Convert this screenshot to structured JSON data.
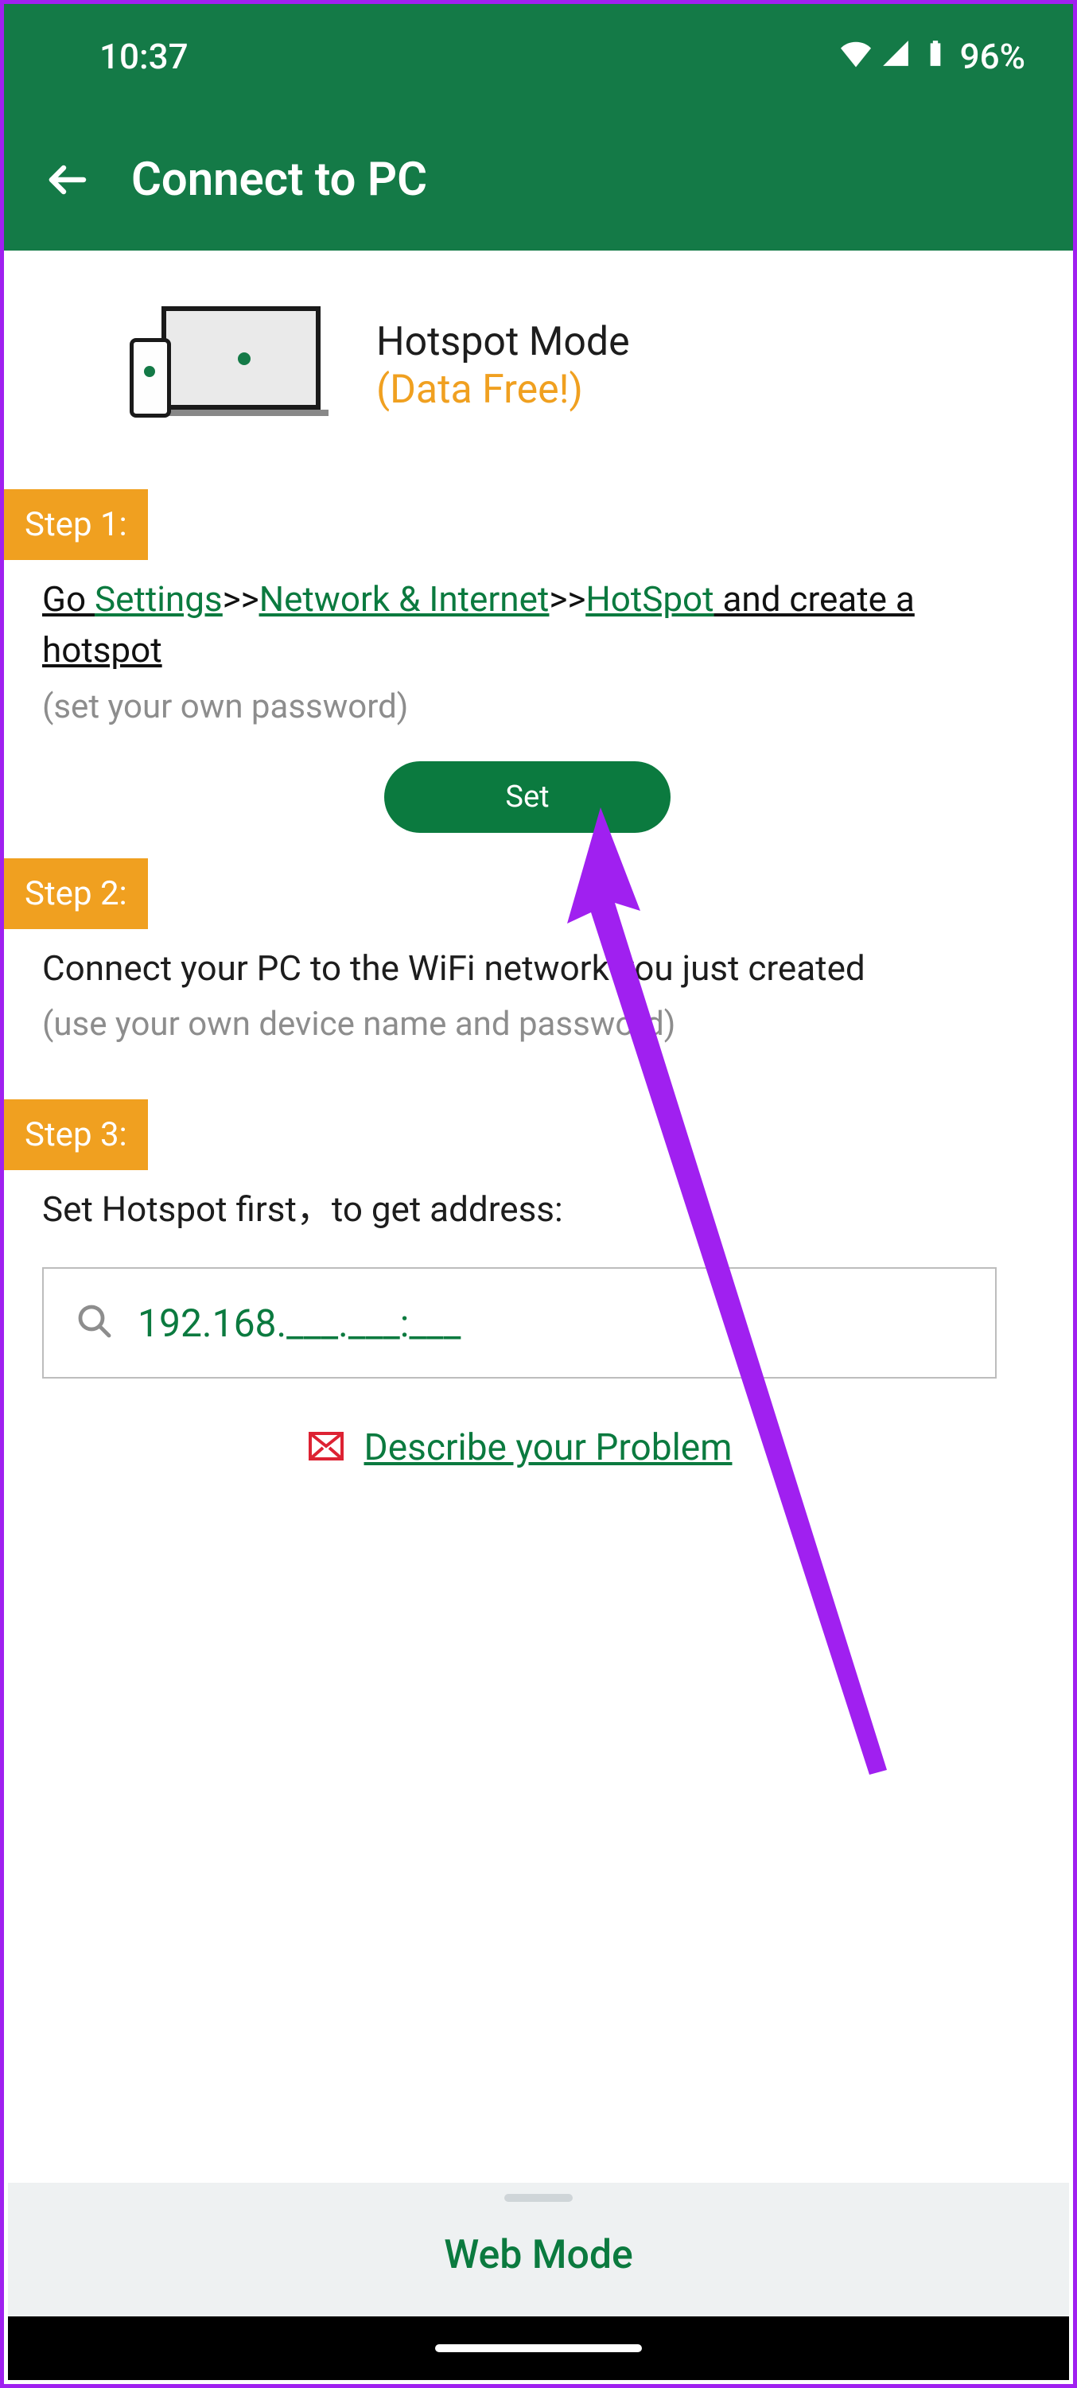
{
  "status": {
    "time": "10:37",
    "battery": "96%"
  },
  "appbar": {
    "title": "Connect to PC"
  },
  "hero": {
    "title": "Hotspot Mode",
    "subtitle": "(Data Free!)"
  },
  "steps": {
    "s1": {
      "badge": "Step 1:",
      "go": "Go ",
      "settings": "Settings",
      "sep1": " >> ",
      "network": "Network & Internet",
      "sep2": " >> ",
      "hotspot": "HotSpot",
      "tail": " and create a hotspot",
      "note": "(set your own password)",
      "set_label": "Set"
    },
    "s2": {
      "badge": "Step 2:",
      "text": "Connect your PC to the WiFi network you just created",
      "note": "(use your own device name and password)"
    },
    "s3": {
      "badge": "Step 3:",
      "text": "Set Hotspot first，to get address:"
    }
  },
  "ip": {
    "placeholder": "192.168.___.___:___"
  },
  "describe": {
    "label": "Describe your Problem"
  },
  "bottom": {
    "label": "Web Mode"
  }
}
